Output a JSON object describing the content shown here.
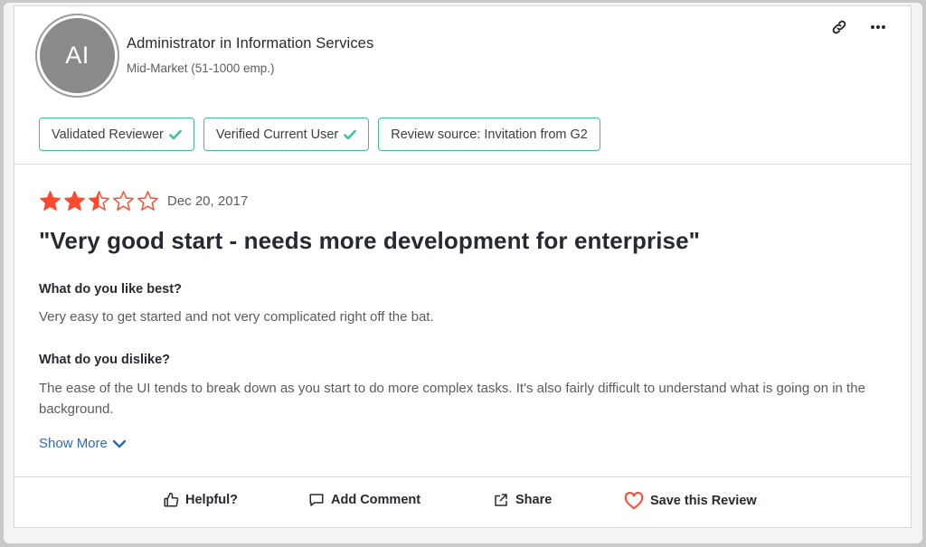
{
  "reviewer": {
    "initials": "AI",
    "title": "Administrator in Information Services",
    "company_size": "Mid-Market (51-1000 emp.)"
  },
  "badges": [
    {
      "label": "Validated Reviewer",
      "check": true
    },
    {
      "label": "Verified Current User",
      "check": true
    },
    {
      "label": "Review source: Invitation from G2",
      "check": false
    }
  ],
  "review": {
    "rating": 2.5,
    "max_rating": 5,
    "date": "Dec 20, 2017",
    "title": "\"Very good start - needs more development for enterprise\"",
    "like_question": "What do you like best?",
    "like_answer": "Very easy to get started and not very complicated right off the bat.",
    "dislike_question": "What do you dislike?",
    "dislike_answer": "The ease of the UI tends to break down as you start to do more complex tasks. It's also fairly difficult to understand what is going on in the background.",
    "show_more": "Show More"
  },
  "actions": {
    "helpful": "Helpful?",
    "add_comment": "Add Comment",
    "share": "Share",
    "save": "Save this Review"
  },
  "colors": {
    "star": "#ff492c",
    "badge_border": "#46b89a",
    "check": "#3fc29a",
    "link": "#2a6db5",
    "heart": "#ff492c"
  },
  "icons": {
    "link": "link-icon",
    "more": "more-horizontal-icon",
    "helpful": "thumbs-up-icon",
    "comment": "comment-icon",
    "share": "share-icon",
    "save": "heart-icon"
  }
}
